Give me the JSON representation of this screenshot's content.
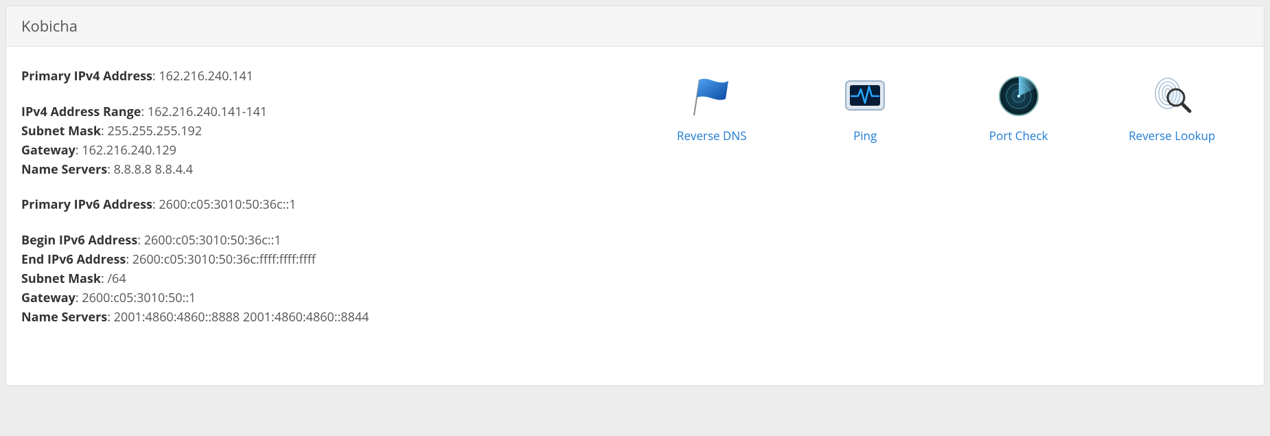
{
  "header": {
    "title": "Kobicha"
  },
  "ipv4": {
    "primary_label": "Primary IPv4 Address",
    "primary_value": "162.216.240.141",
    "range_label": "IPv4 Address Range",
    "range_value": "162.216.240.141-141",
    "subnet_label": "Subnet Mask",
    "subnet_value": "255.255.255.192",
    "gateway_label": "Gateway",
    "gateway_value": "162.216.240.129",
    "ns_label": "Name Servers",
    "ns_value": "8.8.8.8   8.8.4.4"
  },
  "ipv6": {
    "primary_label": "Primary IPv6 Address",
    "primary_value": "2600:c05:3010:50:36c::1",
    "begin_label": "Begin IPv6 Address",
    "begin_value": "2600:c05:3010:50:36c::1",
    "end_label": "End IPv6 Address",
    "end_value": "2600:c05:3010:50:36c:ffff:ffff:ffff",
    "subnet_label": "Subnet Mask",
    "subnet_value": "/64",
    "gateway_label": "Gateway",
    "gateway_value": "2600:c05:3010:50::1",
    "ns_label": "Name Servers",
    "ns_value": "2001:4860:4860::8888   2001:4860:4860::8844"
  },
  "tools": {
    "rdns": "Reverse DNS",
    "ping": "Ping",
    "port": "Port Check",
    "lookup": "Reverse Lookup"
  }
}
